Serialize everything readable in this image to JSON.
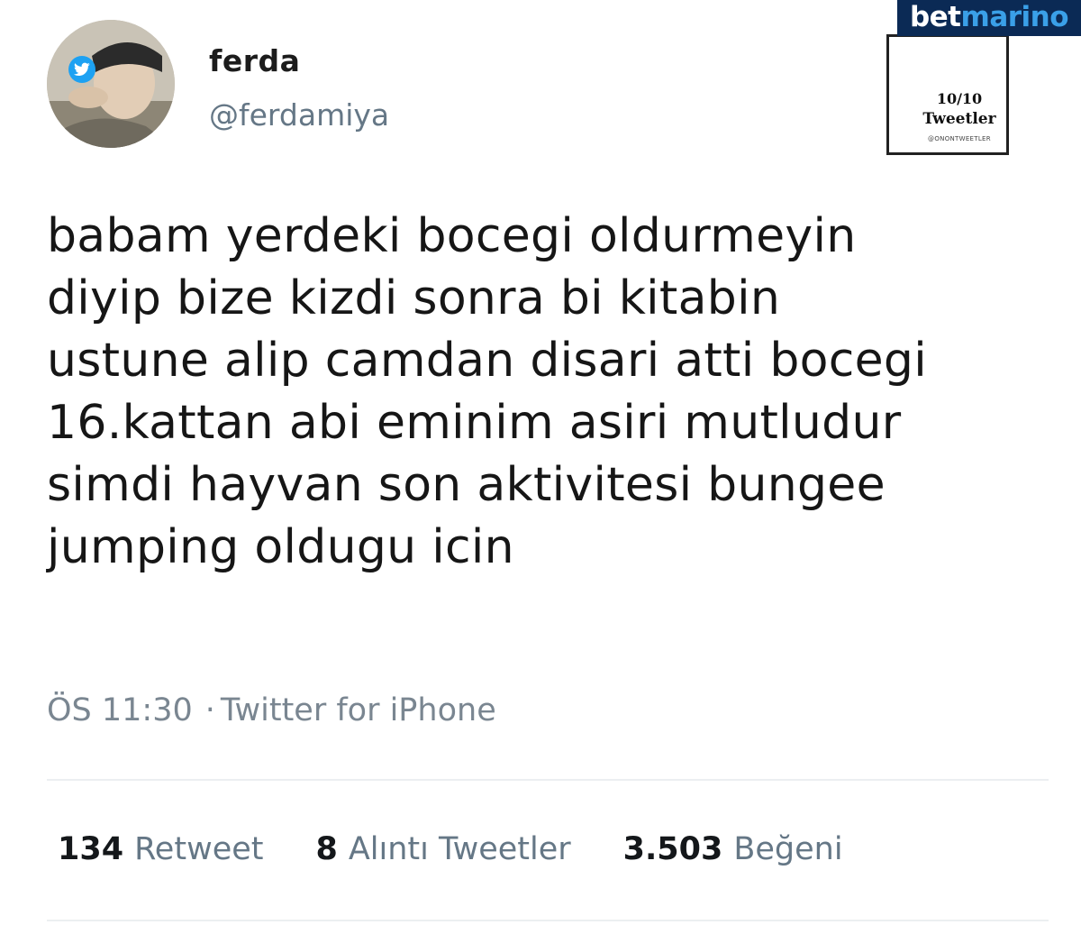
{
  "user": {
    "display_name": "ferda",
    "handle": "@ferdamiya"
  },
  "tweet": {
    "lines": [
      "babam yerdeki bocegi oldurmeyin",
      "diyip bize kizdi sonra bi kitabin",
      "ustune alip camdan disari atti bocegi",
      "16.kattan abi eminim asiri mutludur",
      "simdi hayvan son aktivitesi bungee",
      "jumping oldugu icin"
    ],
    "time": "ÖS 11:30",
    "separator": "·",
    "source": "Twitter for iPhone"
  },
  "stats": {
    "retweets": {
      "count": "134",
      "label": "Retweet"
    },
    "quotes": {
      "count": "8",
      "label": "Alıntı Tweetler"
    },
    "likes": {
      "count": "3.503",
      "label": "Beğeni"
    }
  },
  "overlay": {
    "brand_part1": "bet",
    "brand_part2": "marino",
    "icon": "twitter-bird-icon",
    "ratio": "10/10",
    "label": "Tweetler",
    "handle": "@ONONTWEETLER"
  },
  "colors": {
    "twitter_blue": "#1da1f2",
    "brand_navy": "#0b2a55",
    "muted_text": "#657786"
  }
}
